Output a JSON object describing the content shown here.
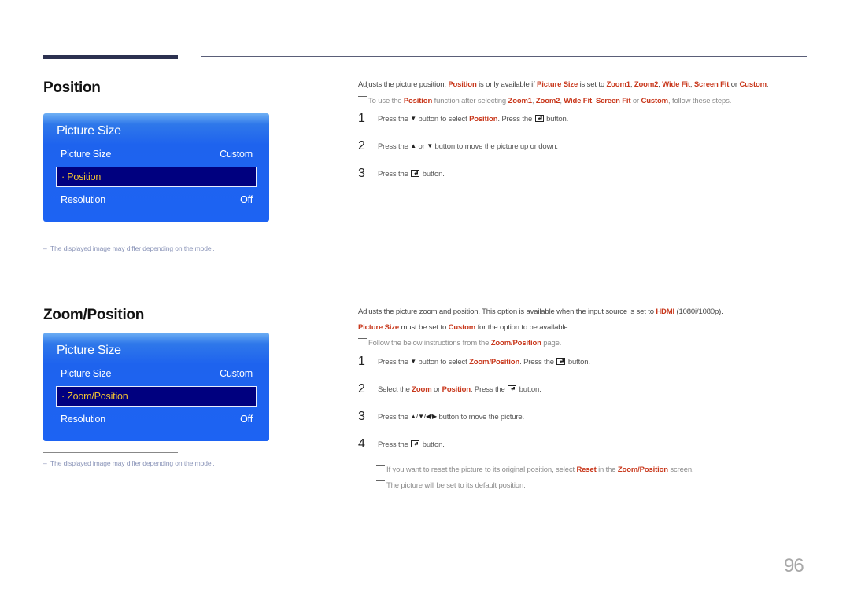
{
  "page_number": "96",
  "footnote_dash": "–",
  "sections": {
    "position": {
      "title": "Position",
      "osd": {
        "title": "Picture Size",
        "row1_label": "Picture Size",
        "row1_value": "Custom",
        "selected_item": "· Position",
        "row3_label": "Resolution",
        "row3_value": "Off"
      },
      "footnote": "The displayed image may differ depending on the model.",
      "description": {
        "t1": "Adjusts the picture position. ",
        "h1": "Position",
        "t2": " is only available if ",
        "h2": "Picture Size",
        "t3": " is set to ",
        "h3": "Zoom1",
        "t4": ", ",
        "h4": "Zoom2",
        "t5": ", ",
        "h5": "Wide Fit",
        "t6": ", ",
        "h6": "Screen Fit",
        "t7": " or ",
        "h7": "Custom",
        "t8": "."
      },
      "note": {
        "t1": "To use the ",
        "h1": "Position",
        "t2": " function after selecting ",
        "h2": "Zoom1",
        "t3": ", ",
        "h3": "Zoom2",
        "t4": ", ",
        "h4": "Wide Fit",
        "t5": ", ",
        "h5": "Screen Fit",
        "t6": " or ",
        "h6": "Custom",
        "t7": ", follow these steps."
      },
      "steps": [
        {
          "num": "1",
          "t1": "Press the ",
          "icon": "▼",
          "t2": " button to select ",
          "h1": "Position",
          "t3": ". Press the ",
          "t4": " button."
        },
        {
          "num": "2",
          "t1": "Press the ",
          "icon1": "▲",
          "t2": " or ",
          "icon2": "▼",
          "t3": " button to move the picture up or down."
        },
        {
          "num": "3",
          "t1": "Press the ",
          "t2": " button."
        }
      ]
    },
    "zoom_position": {
      "title": "Zoom/Position",
      "osd": {
        "title": "Picture Size",
        "row1_label": "Picture Size",
        "row1_value": "Custom",
        "selected_item": "· Zoom/Position",
        "row3_label": "Resolution",
        "row3_value": "Off"
      },
      "footnote": "The displayed image may differ depending on the model.",
      "description_line1": {
        "t1": "Adjusts the picture zoom and position. This option is available when the input source is set to ",
        "h1": "HDMI",
        "t2": " (1080i/1080p)."
      },
      "description_line2": {
        "h1": "Picture Size",
        "t1": " must be set to ",
        "h2": "Custom",
        "t2": " for the option to be available."
      },
      "note": {
        "t1": "Follow the below instructions from the ",
        "h1": "Zoom/Position",
        "t2": " page."
      },
      "steps": [
        {
          "num": "1",
          "t1": "Press the ",
          "icon": "▼",
          "t2": " button to select ",
          "h1": "Zoom/Position",
          "t3": ". Press the ",
          "t4": " button."
        },
        {
          "num": "2",
          "t1": "Select the ",
          "h1": "Zoom",
          "t2": " or ",
          "h2": "Position",
          "t3": ". Press the ",
          "t4": " button."
        },
        {
          "num": "3",
          "t1": "Press the ",
          "icons": "▲/▼/◀/▶",
          "t2": " button to move the picture."
        },
        {
          "num": "4",
          "t1": "Press the ",
          "t2": " button."
        }
      ],
      "sub_notes": [
        {
          "t1": "If you want to reset the picture to its original position, select ",
          "h1": "Reset",
          "t2": " in the ",
          "h2": "Zoom/Position",
          "t3": " screen."
        },
        {
          "t1": "The picture will be set to its default position."
        }
      ]
    }
  }
}
